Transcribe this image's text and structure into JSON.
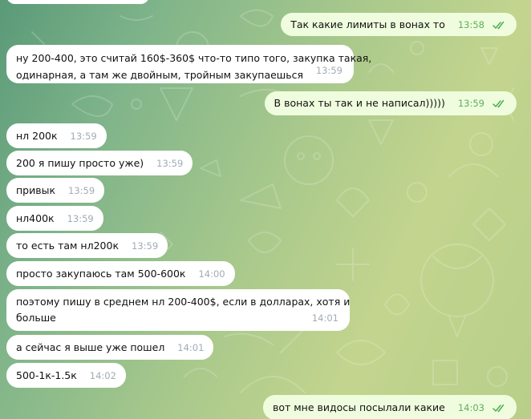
{
  "messages": [
    {
      "id": "m0",
      "direction": "in",
      "text": "",
      "time": ""
    },
    {
      "id": "m1",
      "direction": "out",
      "text": "Так какие лимиты в вонах то",
      "time": "13:58",
      "status": "read"
    },
    {
      "id": "m2",
      "direction": "in",
      "lines": [
        "ну 200-400, это считай 160$-360$ что-то типо того, закупка такая,",
        "одинарная, а там же двойным, тройным закупаешься"
      ],
      "time": "13:59"
    },
    {
      "id": "m3",
      "direction": "out",
      "text": "В вонах ты так и не написал)))))",
      "time": "13:59",
      "status": "read"
    },
    {
      "id": "m4",
      "direction": "in",
      "text": "нл 200к",
      "time": "13:59"
    },
    {
      "id": "m5",
      "direction": "in",
      "text": "200 я пишу просто уже)",
      "time": "13:59"
    },
    {
      "id": "m6",
      "direction": "in",
      "text": "привык",
      "time": "13:59"
    },
    {
      "id": "m7",
      "direction": "in",
      "text": "нл400к",
      "time": "13:59"
    },
    {
      "id": "m8",
      "direction": "in",
      "text": "то есть там нл200к",
      "time": "13:59"
    },
    {
      "id": "m9",
      "direction": "in",
      "text": "просто закупаюсь там 500-600к",
      "time": "14:00"
    },
    {
      "id": "m10",
      "direction": "in",
      "lines": [
        "поэтому пишу в среднем нл 200-400$, если в долларах, хотя и",
        "больше"
      ],
      "time": "14:01"
    },
    {
      "id": "m11",
      "direction": "in",
      "text": "а сейчас я выше уже пошел",
      "time": "14:01"
    },
    {
      "id": "m12",
      "direction": "in",
      "text": "500-1к-1.5к",
      "time": "14:02"
    },
    {
      "id": "m13",
      "direction": "out",
      "text": "вот мне видосы посылали какие",
      "time": "14:03",
      "status": "read"
    }
  ],
  "colors": {
    "incoming_bubble": "#ffffff",
    "outgoing_bubble": "#effdde",
    "outgoing_time": "#5fae5d",
    "incoming_time": "#a0acb6",
    "read_checks": "#4fae4e"
  },
  "icons": {
    "read_status": "double-check-icon",
    "background_pattern": "doodle-pattern"
  }
}
